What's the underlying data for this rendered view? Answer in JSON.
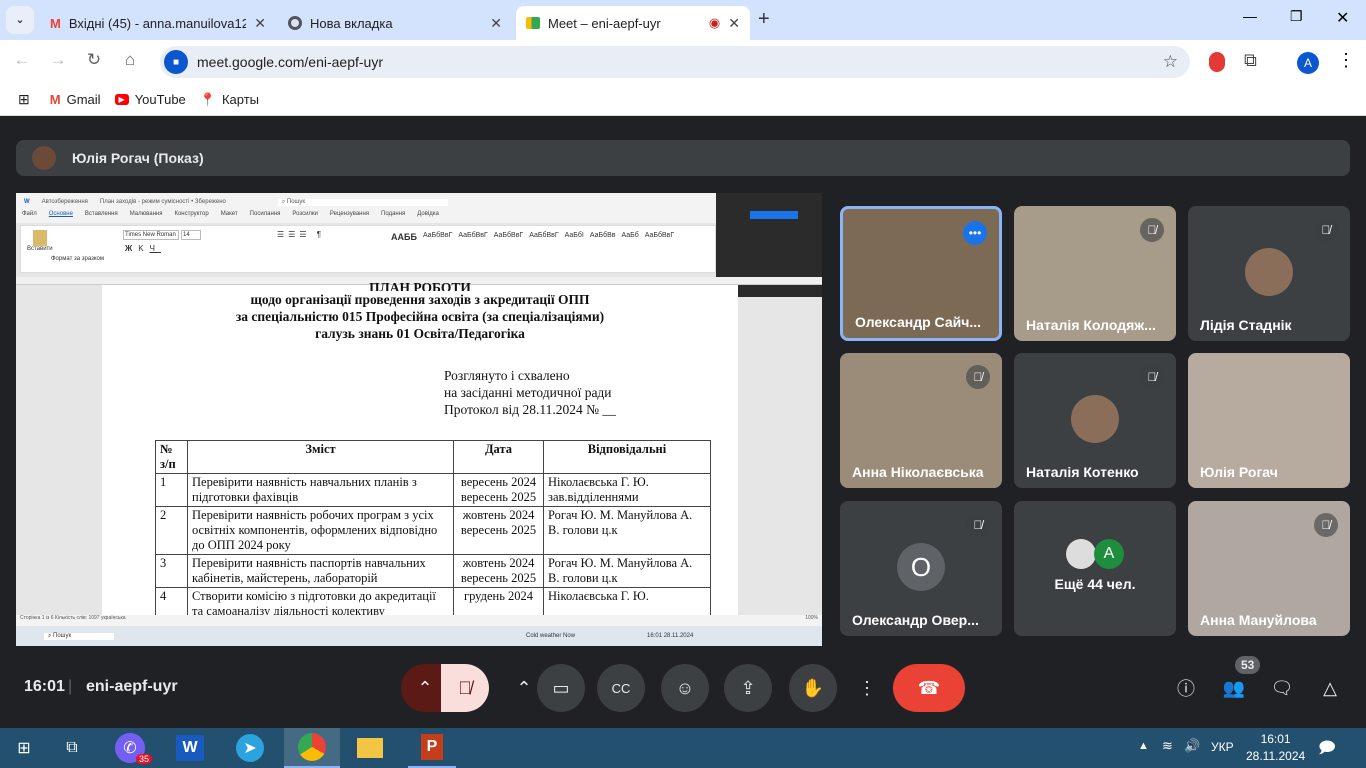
{
  "browser": {
    "tabs": [
      {
        "title": "Вхідні (45) - anna.manuilova12",
        "icon": "gmail-icon"
      },
      {
        "title": "Нова вкладка",
        "icon": "chrome-icon"
      },
      {
        "title": "Meet – eni-aepf-uyr",
        "icon": "meet-icon",
        "active": true,
        "recording": true
      }
    ],
    "url": "meet.google.com/eni-aepf-uyr",
    "profile_initial": "A",
    "bookmarks": [
      "Gmail",
      "YouTube",
      "Карты"
    ]
  },
  "meet": {
    "presenter_label": "Юлія Рогач (Показ)",
    "time": "16:01",
    "meeting_code": "eni-aepf-uyr",
    "participants_count": "53",
    "tiles": [
      {
        "name": "Олександр Сайч...",
        "speaking": true
      },
      {
        "name": "Наталія Колодяж...",
        "muted": true
      },
      {
        "name": "Лідія Стаднік",
        "muted": true
      },
      {
        "name": "Анна Ніколаєвська",
        "muted": true
      },
      {
        "name": "Наталія Котенко",
        "muted": true
      },
      {
        "name": "Юлія Рогач"
      },
      {
        "name": "Олександр Овер...",
        "initial": "O",
        "muted": true
      },
      {
        "name": "Ещё 44 чел.",
        "initial": "A"
      },
      {
        "name": "Анна Мануйлова",
        "muted": true
      }
    ],
    "accent": "#8ab4f8",
    "end_call_color": "#ea4335"
  },
  "word": {
    "title": "План заходів - режим сумісності • Збережено",
    "search": "Пошук",
    "autosave": "Автозбереження",
    "menu": [
      "Файл",
      "Основне",
      "Вставлення",
      "Малювання",
      "Конструктор",
      "Макет",
      "Посилання",
      "Розсилки",
      "Рецензування",
      "Подання",
      "Довідка"
    ],
    "font": "Times New Roman",
    "size": "14",
    "paste": "Вставити",
    "format_painter": "Формат за зразком",
    "styles": [
      "ААББ",
      "АаБбВвГ",
      "АаБбВвГ",
      "АаБбВвГ",
      "АаБбВвГ",
      "АаБбІ",
      "АаБбВв",
      "АаБб",
      "АаБбВвГ"
    ],
    "status": "Сторінка 1 із 6   Кількість слів: 1097   українська",
    "zoom": "100%",
    "doc": {
      "title_cut": "ПЛАН РОБОТИ",
      "subtitle": [
        "щодо організації проведення заходів з акредитації ОПП",
        "за спеціальністю 015 Професійна освіта (за спеціалізаціями)",
        "галузь знань 01 Освіта/Педагогіка"
      ],
      "approval": [
        "Розглянуто і схвалено",
        "на засіданні методичної ради",
        "Протокол від 28.11.2024 № __"
      ],
      "headers": [
        "№ з/п",
        "Зміст",
        "Дата",
        "Відповідальні"
      ],
      "rows": [
        [
          "1",
          "Перевірити наявність навчальних планів з підготовки фахівців",
          "вересень 2024 вересень 2025",
          "Ніколаєвська Г. Ю. зав.відділеннями"
        ],
        [
          "2",
          "Перевірити наявність робочих програм з усіх освітніх компонентів, оформлених відповідно до ОПП 2024 року",
          "жовтень 2024 вересень 2025",
          "Рогач Ю. М. Мануйлова А. В. голови ц.к"
        ],
        [
          "3",
          "Перевірити наявність паспортів навчальних кабінетів, майстерень, лабораторій",
          "жовтень 2024 вересень 2025",
          "Рогач Ю. М. Мануйлова А. В. голови ц.к"
        ],
        [
          "4",
          "Створити комісію з підготовки до акредитації та самоаналізу діяльності колективу",
          "грудень 2024",
          "Ніколаєвська Г. Ю."
        ]
      ]
    },
    "inner_taskbar": {
      "search": "Пошук",
      "weather": "Cold weather Now",
      "clock": "16:01 28.11.2024"
    }
  },
  "taskbar": {
    "viber_badge": "35",
    "lang": "УКР",
    "time": "16:01",
    "date": "28.11.2024"
  }
}
